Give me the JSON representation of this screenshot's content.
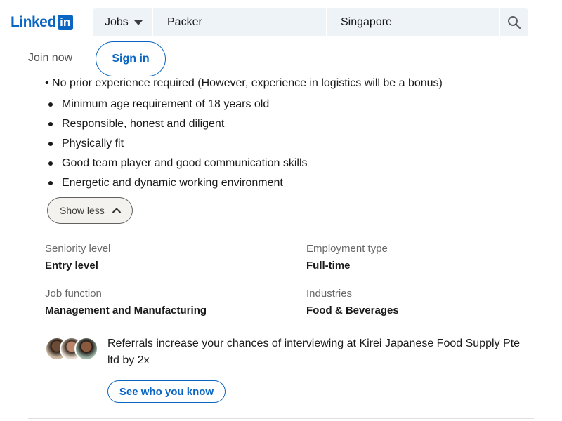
{
  "header": {
    "logo_text": "Linked",
    "logo_badge": "in",
    "brand_color": "#0a66c2",
    "search": {
      "type_label": "Jobs",
      "keyword_value": "Packer",
      "location_value": "Singapore",
      "search_icon": "search-icon"
    },
    "join_now": "Join now",
    "sign_in": "Sign in"
  },
  "job": {
    "cut_off_line": "No prior experience required (However, experience in logistics will be a bonus)",
    "requirements": [
      "Minimum age requirement of 18 years old",
      "Responsible, honest and diligent",
      "Physically fit",
      "Good team player and good communication skills",
      "Energetic and dynamic working environment"
    ],
    "show_less": "Show less",
    "criteria": [
      {
        "label": "Seniority level",
        "value": "Entry level"
      },
      {
        "label": "Employment type",
        "value": "Full-time"
      },
      {
        "label": "Job function",
        "value": "Management and Manufacturing"
      },
      {
        "label": "Industries",
        "value": "Food & Beverages"
      }
    ]
  },
  "referral": {
    "text": "Referrals increase your chances of interviewing at Kirei Japanese Food Supply Pte ltd by 2x",
    "button": "See who you know"
  }
}
